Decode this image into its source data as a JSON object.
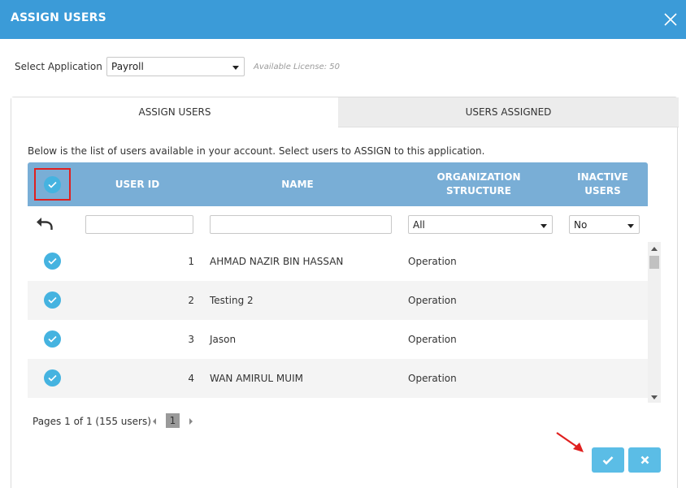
{
  "dialog": {
    "title": "ASSIGN USERS"
  },
  "application": {
    "label": "Select Application",
    "selected": "Payroll",
    "license": "Available License: 50"
  },
  "tabs": [
    {
      "label": "ASSIGN USERS",
      "active": true
    },
    {
      "label": "USERS ASSIGNED",
      "active": false
    }
  ],
  "description": "Below is the list of users available in your account. Select users to ASSIGN to this application.",
  "table": {
    "headers": {
      "user_id": "USER ID",
      "name": "NAME",
      "org": "ORGANIZATION STRUCTURE",
      "inactive_line1": "INACTIVE",
      "inactive_line2": "USERS"
    },
    "filters": {
      "org_value": "All",
      "inactive_value": "No"
    },
    "rows": [
      {
        "id": "1",
        "name": "AHMAD NAZIR BIN HASSAN",
        "org": "Operation",
        "checked": true
      },
      {
        "id": "2",
        "name": "Testing 2",
        "org": "Operation",
        "checked": true
      },
      {
        "id": "3",
        "name": "Jason",
        "org": "Operation",
        "checked": true
      },
      {
        "id": "4",
        "name": "WAN AMIRUL MUIM",
        "org": "Operation",
        "checked": true
      }
    ]
  },
  "pager": {
    "text": "Pages 1 of 1 (155 users)",
    "current_page": "1"
  },
  "colors": {
    "header_bar": "#3b9bd8",
    "table_header": "#79aed6",
    "check": "#45b3e0",
    "button": "#5bbde6",
    "highlight": "#e0201f"
  },
  "icons": {
    "close": "close-icon",
    "undo": "undo-arrow-icon",
    "check": "check-icon",
    "confirm": "checkmark-icon",
    "cancel": "x-icon"
  }
}
